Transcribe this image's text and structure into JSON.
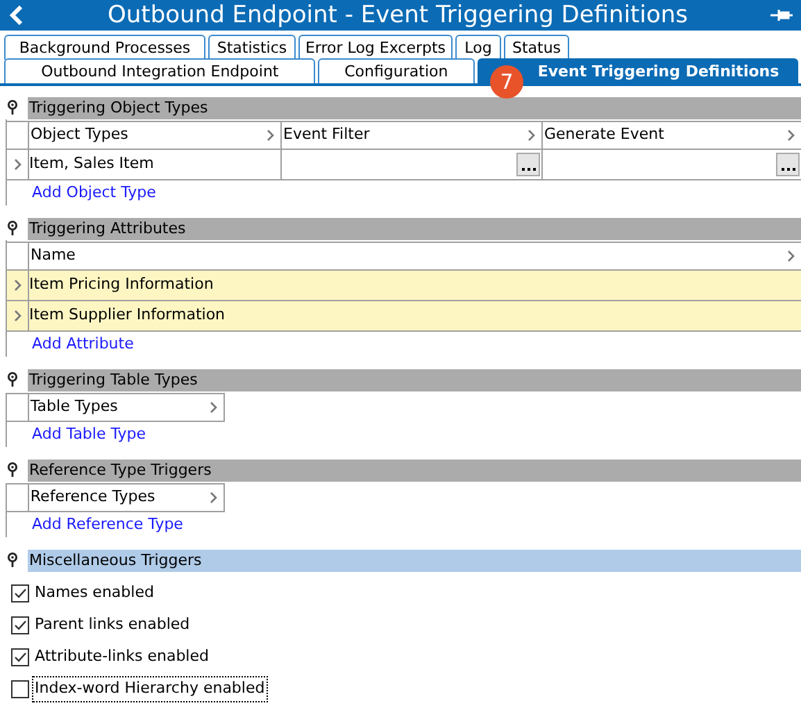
{
  "window": {
    "title": "Outbound Endpoint - Event Triggering Definitions"
  },
  "tab_rows": [
    [
      {
        "label": "Background Processes",
        "selected": false
      },
      {
        "label": "Statistics",
        "selected": false
      },
      {
        "label": "Error Log Excerpts",
        "selected": false
      },
      {
        "label": "Log",
        "selected": false
      },
      {
        "label": "Status",
        "selected": false
      }
    ],
    [
      {
        "label": "Outbound Integration Endpoint",
        "selected": false
      },
      {
        "label": "Configuration",
        "selected": false
      },
      {
        "label": "Event Triggering Definitions",
        "selected": true
      }
    ]
  ],
  "step_badge": "7",
  "sections": [
    {
      "kind": "table",
      "title": "Triggering Object Types",
      "selected": false,
      "columns": [
        "Object Types",
        "Event Filter",
        "Generate Event"
      ],
      "rows": [
        {
          "cells": [
            "Item, Sales Item",
            "",
            ""
          ],
          "highlighted": false
        }
      ],
      "add_link": "Add Object Type"
    },
    {
      "kind": "table",
      "title": "Triggering Attributes",
      "selected": false,
      "columns": [
        "Name"
      ],
      "rows": [
        {
          "cells": [
            "Item Pricing Information"
          ],
          "highlighted": true
        },
        {
          "cells": [
            "Item Supplier Information"
          ],
          "highlighted": true
        }
      ],
      "add_link": "Add Attribute"
    },
    {
      "kind": "table",
      "title": "Triggering Table Types",
      "selected": false,
      "columns": [
        "Table Types"
      ],
      "add_link": "Add Table Type"
    },
    {
      "kind": "table",
      "title": "Reference Type Triggers",
      "selected": false,
      "columns": [
        "Reference Types"
      ],
      "add_link": "Add Reference Type"
    },
    {
      "kind": "checks",
      "title": "Miscellaneous Triggers",
      "selected": true,
      "options": [
        {
          "label": "Names enabled",
          "checked": true,
          "focused": false
        },
        {
          "label": "Parent links enabled",
          "checked": true,
          "focused": false
        },
        {
          "label": "Attribute-links enabled",
          "checked": true,
          "focused": false
        },
        {
          "label": "Index-word Hierarchy enabled",
          "checked": false,
          "focused": true
        }
      ]
    }
  ]
}
